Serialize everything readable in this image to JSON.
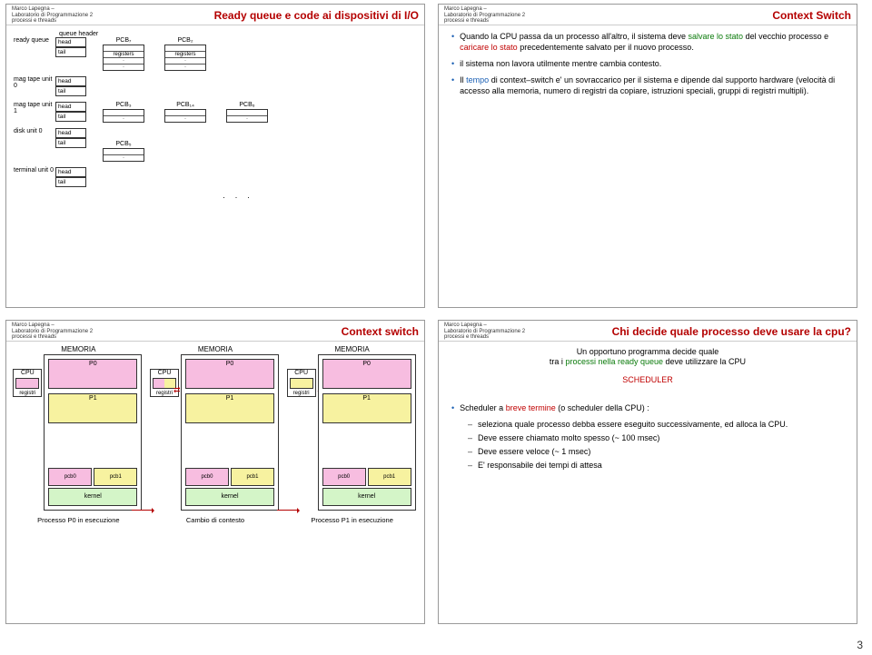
{
  "author": {
    "name": "Marco Lapegna –",
    "course": "Laboratorio di Programmazione 2",
    "topic": "processi e threads"
  },
  "page_number": "3",
  "slide1": {
    "title": "Ready queue e code ai dispositivi di I/O",
    "queue_header_label": "queue header",
    "ready_queue_label": "ready queue",
    "head": "head",
    "tail": "tail",
    "registers": "registers",
    "mag_tape_0": "mag tape unit 0",
    "mag_tape_1": "mag tape unit 1",
    "disk_0": "disk unit 0",
    "terminal_0": "terminal unit 0",
    "pcb_labels": [
      "PCB₇",
      "PCB₂",
      "PCB₃",
      "PCB₁₄",
      "PCB₆",
      "PCB₅"
    ]
  },
  "slide2": {
    "title": "Context Switch",
    "bullets": [
      "Quando la CPU passa da un processo all'altro, il sistema deve",
      "il sistema non lavora utilmente mentre cambia contesto.",
      "Il"
    ],
    "hl": {
      "salvare": "salvare lo stato",
      "vecchio": "del vecchio processo e",
      "caricare": "caricare lo stato",
      "precedentemente": "precedentemente salvato per il nuovo processo.",
      "tempo": "tempo",
      "di_cs": "di context–switch e' un sovraccarico per il sistema e dipende dal supporto hardware (velocità di accesso alla memoria, numero di registri da copiare, istruzioni speciali, gruppi di registri multipli)."
    }
  },
  "slide3": {
    "title": "Context switch",
    "memoria": "MEMORIA",
    "cpu": "CPU",
    "registri": "registri",
    "p0": "P0",
    "p1": "P1",
    "pcb0": "pcb0",
    "pcb1": "pcb1",
    "kernel": "kernel",
    "captions": [
      "Processo P0 in esecuzione",
      "Cambio di contesto",
      "Processo P1 in esecuzione"
    ]
  },
  "slide4": {
    "title": "Chi decide quale processo deve usare la cpu?",
    "intro1": "Un opportuno programma decide quale",
    "intro2_pre": "tra i ",
    "intro2_green": "processi nella ready queue",
    "intro2_post": " deve utilizzare la CPU",
    "scheduler": "SCHEDULER",
    "bullet": "Scheduler a",
    "breve": "breve termine",
    "bullet_post": " (o scheduler della CPU) :",
    "subs": [
      "seleziona quale processo debba essere eseguito successivamente, ed alloca la CPU.",
      "Deve essere chiamato molto spesso (~ 100 msec)",
      "Deve essere veloce (~ 1 msec)",
      "E' responsabile dei tempi di attesa"
    ]
  }
}
